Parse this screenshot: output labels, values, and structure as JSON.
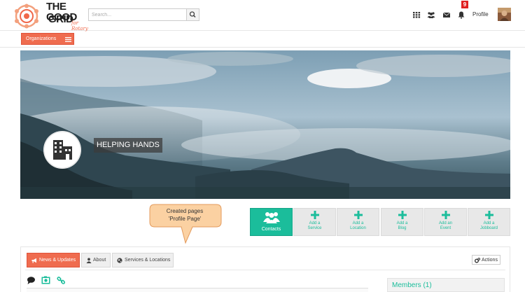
{
  "brand": {
    "line1": "THE GOOD",
    "line2": "GRID",
    "tagline": "for Rotary",
    "accent_color": "#ef6c4f"
  },
  "search": {
    "placeholder": "Search..."
  },
  "header": {
    "icons": [
      "apps-grid-icon",
      "users-icon",
      "envelope-icon",
      "bell-icon"
    ],
    "notification_count": "9",
    "profile_label": "Profile"
  },
  "orgbar": {
    "button_label": "Organizations"
  },
  "cover": {
    "org_name": "HELPING HANDS"
  },
  "callout": {
    "line1": "Created pages",
    "line2": "'Profile Page'"
  },
  "actions": {
    "tiles": [
      {
        "label": "Contacts",
        "icon": "contacts-icon",
        "active": true
      },
      {
        "label": "Add a Service",
        "line1": "Add a",
        "line2": "Service",
        "icon": "plus-icon"
      },
      {
        "label": "Add a Location",
        "line1": "Add a",
        "line2": "Location",
        "icon": "plus-icon"
      },
      {
        "label": "Add a Blog",
        "line1": "Add a",
        "line2": "Blog",
        "icon": "plus-icon"
      },
      {
        "label": "Add an Event",
        "line1": "Add an",
        "line2": "Event",
        "icon": "plus-icon"
      },
      {
        "label": "Add a Jobboard",
        "line1": "Add a",
        "line2": "Jobboard",
        "icon": "plus-icon"
      }
    ],
    "teal_color": "#1bbd9b"
  },
  "tabs": [
    {
      "label": "News & Updates",
      "icon": "megaphone-icon",
      "active": true
    },
    {
      "label": "About",
      "icon": "user-icon"
    },
    {
      "label": "Services & Locations",
      "icon": "globe-icon"
    }
  ],
  "actions_button": {
    "label": "Actions"
  },
  "composer_icons": [
    "comment-icon",
    "photo-icon",
    "link-icon"
  ],
  "sidebar": {
    "members_label": "Members (1)"
  }
}
